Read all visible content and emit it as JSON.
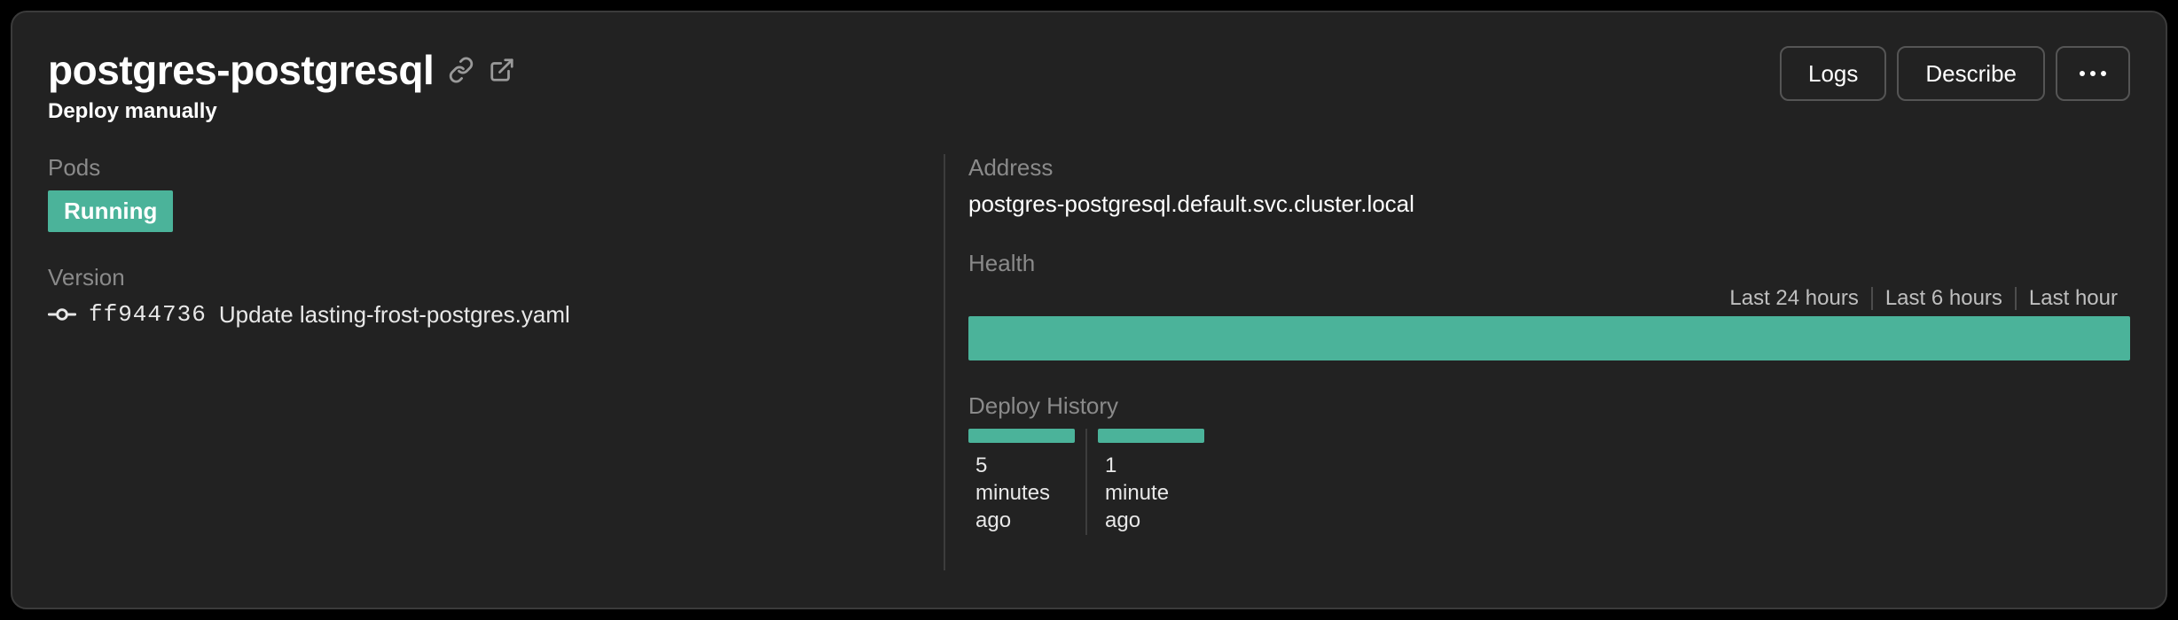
{
  "header": {
    "title": "postgres-postgresql",
    "subtitle": "Deploy manually",
    "actions": {
      "logs": "Logs",
      "describe": "Describe"
    }
  },
  "pods": {
    "label": "Pods",
    "status": "Running",
    "status_color": "#4bb39a"
  },
  "version": {
    "label": "Version",
    "hash": "ff944736",
    "message": "Update lasting-frost-postgres.yaml"
  },
  "address": {
    "label": "Address",
    "value": "postgres-postgresql.default.svc.cluster.local"
  },
  "health": {
    "label": "Health",
    "legend": [
      "Last 24 hours",
      "Last 6 hours",
      "Last hour"
    ],
    "bar_color": "#4bb39a"
  },
  "deploy_history": {
    "label": "Deploy History",
    "items": [
      {
        "age": "5 minutes ago"
      },
      {
        "age": "1 minute ago"
      }
    ]
  }
}
